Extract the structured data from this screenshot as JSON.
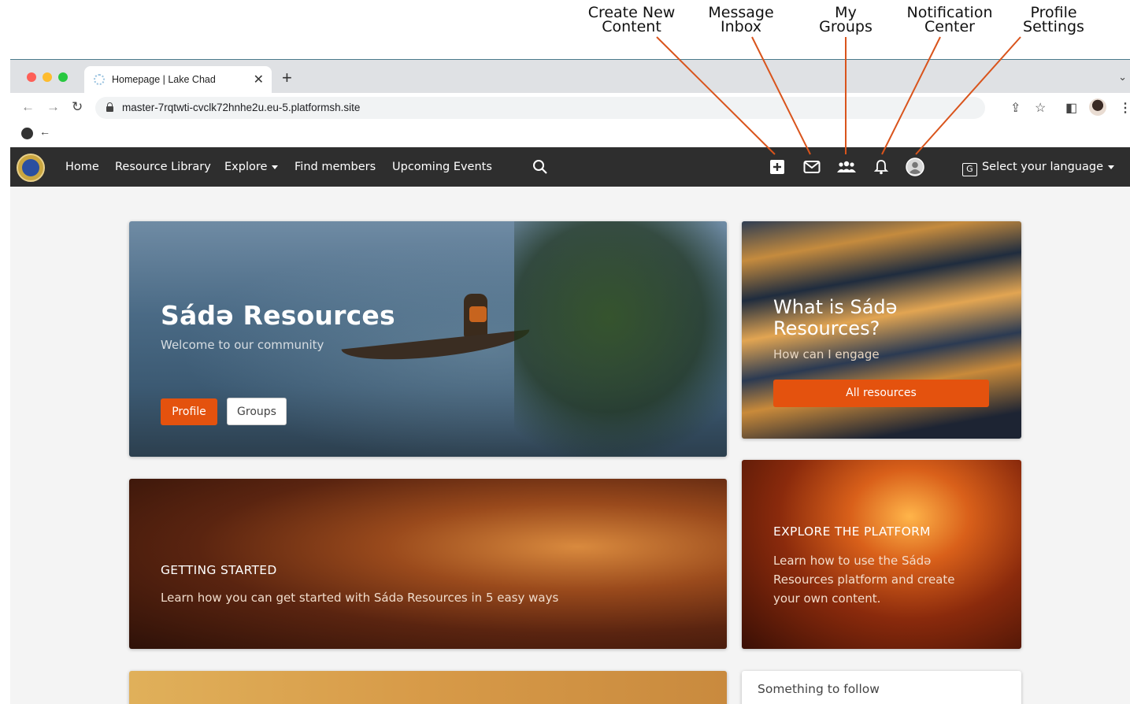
{
  "annotations": [
    {
      "line1": "Create New",
      "line2": "Content"
    },
    {
      "line1": "Message",
      "line2": "Inbox"
    },
    {
      "line1": "My",
      "line2": "Groups"
    },
    {
      "line1": "Notification",
      "line2": "Center"
    },
    {
      "line1": "Profile",
      "line2": "Settings"
    }
  ],
  "browser": {
    "tab_title": "Homepage | Lake Chad",
    "url": "master-7rqtwti-cvclk72hnhe2u.eu-5.platformsh.site"
  },
  "navbar": {
    "links": [
      "Home",
      "Resource Library",
      "Explore",
      "Find members",
      "Upcoming Events"
    ],
    "language": "Select your language"
  },
  "hero": {
    "title": "Sádə Resources",
    "subtitle": "Welcome to our community",
    "profile_btn": "Profile",
    "groups_btn": "Groups"
  },
  "whatis": {
    "title": "What is Sádə Resources?",
    "subtitle": "How can I engage",
    "button": "All resources"
  },
  "getting_started": {
    "title": "GETTING STARTED",
    "text": "Learn how you can get started with  Sádə Resources in 5 easy ways"
  },
  "explore": {
    "title": "EXPLORE THE PLATFORM",
    "text": "Learn how to use the  Sádə Resources  platform and create your own content."
  },
  "follow": {
    "title": "Something to follow"
  },
  "colors": {
    "accent": "#e4520e",
    "navbar": "#2e2e2e",
    "annotation_line": "#d9541c"
  }
}
